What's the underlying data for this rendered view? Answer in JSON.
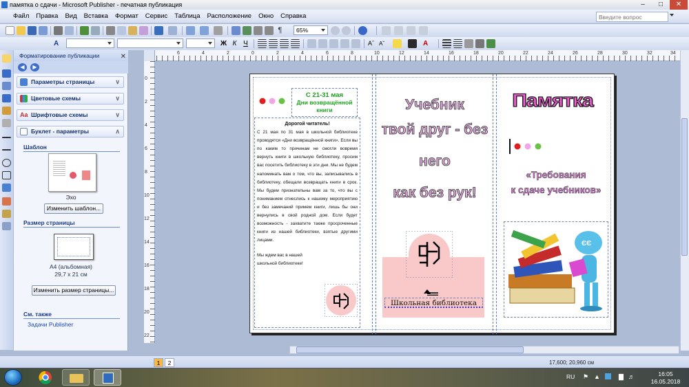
{
  "window": {
    "title": "памятка о сдачи - Microsoft Publisher - печатная публикация"
  },
  "menu": [
    "Файл",
    "Правка",
    "Вид",
    "Вставка",
    "Формат",
    "Сервис",
    "Таблица",
    "Расположение",
    "Окно",
    "Справка"
  ],
  "help_search": {
    "placeholder": "Введите вопрос"
  },
  "toolbar": {
    "zoom": "65%"
  },
  "task_pane": {
    "title": "Форматирование публикации",
    "sections": [
      "Параметры страницы",
      "Цветовые схемы",
      "Шрифтовые схемы",
      "Буклет - параметры"
    ],
    "template_label": "Шаблон",
    "template_name": "Эхо",
    "change_template_button": "Изменить шаблон...",
    "page_size_label": "Размер страницы",
    "page_size_name": "A4 (альбомная)",
    "page_size_dims": "29,7 x 21 см",
    "change_size_button": "Изменить размер страницы...",
    "see_also_label": "См. также",
    "see_also_link": "Задачи Publisher"
  },
  "document": {
    "panel1": {
      "date_title": "С 21-31 мая",
      "date_subtitle": "Дни возвращённой книги",
      "greeting": "Дорогой читатель!",
      "body": "С 21 мая по 31 мая в школьной библиотеке проводятся «Дни возвращённой книги». Если вы по каким то причинам не смогли вовремя вернуть книги в школьную библиотеку, просим вас посетить библиотеку в эти дни. Мы не будем напоминать вам о том, что вы, записывались в библиотеку, обещали возвращать книги в срок. Мы будем признательны вам за то, что вы с пониманием отнеслись к нашему мероприятию и без замечаний примем книги, лишь бы они вернулись в свой родной дом. Если будет возможность - захватите также просроченные книги из нашей библиотеки, взятые другими лицами.",
      "closing": "Мы ждем вас в нашей школьной библиотеке!"
    },
    "panel2": {
      "line1": "Учебник",
      "line2": "твой друг - без него",
      "line3": "как без рук!",
      "library_name": "Школьная библиотека"
    },
    "panel3": {
      "title": "Памятка",
      "subtitle_line1": "«Требования",
      "subtitle_line2": "к сдаче учебников»"
    }
  },
  "rulers": {
    "h_ticks": [
      "6",
      "4",
      "2",
      "0",
      "2",
      "4",
      "6",
      "8",
      "10",
      "12",
      "14",
      "16",
      "18",
      "20",
      "22",
      "24",
      "26",
      "28",
      "30",
      "32",
      "34"
    ],
    "v_ticks": [
      "0",
      "2",
      "4",
      "6",
      "8",
      "10",
      "12",
      "14",
      "16",
      "18",
      "20",
      "22"
    ]
  },
  "status": {
    "pages": [
      "1",
      "2"
    ],
    "coords": "17,600; 20,960 см"
  },
  "tray": {
    "lang": "RU",
    "time": "16:05",
    "date": "16.05.2018"
  },
  "colors": {
    "accent": "#ff33cc",
    "title_text": "#d9a0d8",
    "pink_box": "#f9c9c9"
  }
}
